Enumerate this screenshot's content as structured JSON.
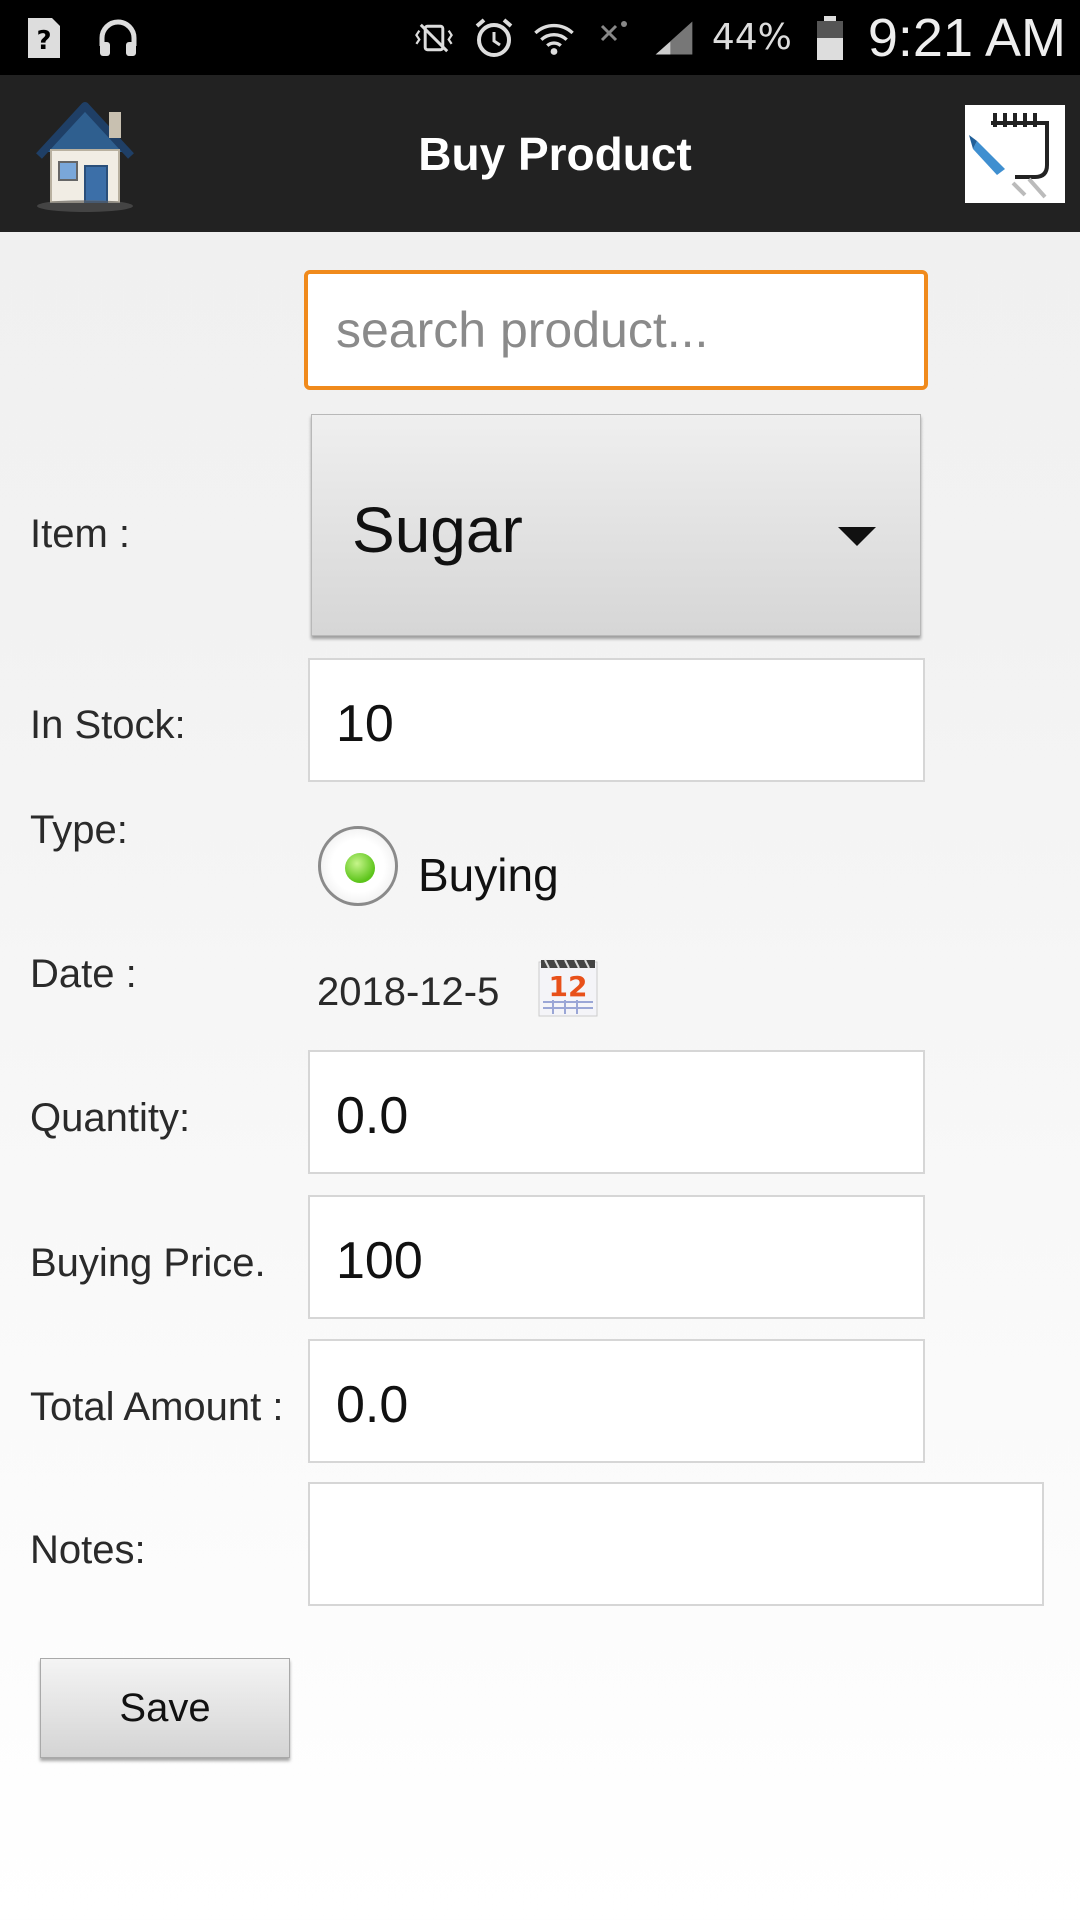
{
  "status_bar": {
    "battery_percent": "44%",
    "time": "9:21 AM",
    "icons": [
      "unknown-app-icon",
      "headset-icon",
      "vibrate-mute-icon",
      "alarm-icon",
      "wifi-icon",
      "no-sim-icon",
      "signal-icon",
      "battery-icon"
    ]
  },
  "app_bar": {
    "title": "Buy Product",
    "left_icon": "home-icon",
    "right_icon": "edit-note-icon"
  },
  "search": {
    "placeholder": "search product...",
    "value": ""
  },
  "form": {
    "item_label": "Item :",
    "item_value": "Sugar",
    "in_stock_label": "In Stock:",
    "in_stock_value": "10",
    "type_label": "Type:",
    "type_option": "Buying",
    "type_selected": true,
    "date_label": "Date :",
    "date_value": "2018-12-5",
    "calendar_icon_text": "12",
    "quantity_label": "Quantity:",
    "quantity_value": "0.0",
    "buying_price_label": "Buying Price.",
    "buying_price_value": "100",
    "total_amount_label": "Total Amount :",
    "total_amount_value": "0.0",
    "notes_label": "Notes:",
    "notes_value": ""
  },
  "actions": {
    "save_label": "Save"
  },
  "colors": {
    "search_border": "#f08a1c",
    "app_bar": "#222222",
    "radio_selected": "#5cc41a"
  }
}
